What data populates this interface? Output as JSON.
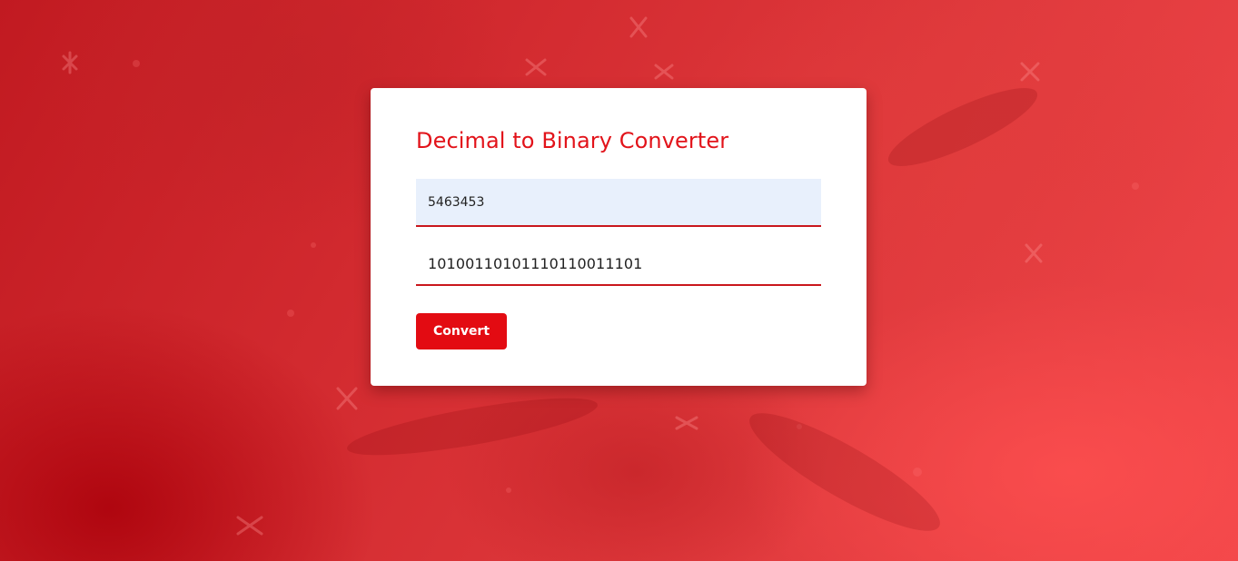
{
  "converter": {
    "title": "Decimal to Binary Converter",
    "decimal_input_value": "5463453",
    "binary_output_value": "10100110101110110011101",
    "convert_label": "Convert"
  },
  "colors": {
    "accent": "#e2131a",
    "button": "#e30b12",
    "input_fill": "#e8f0fc",
    "background": "#d3262b"
  }
}
